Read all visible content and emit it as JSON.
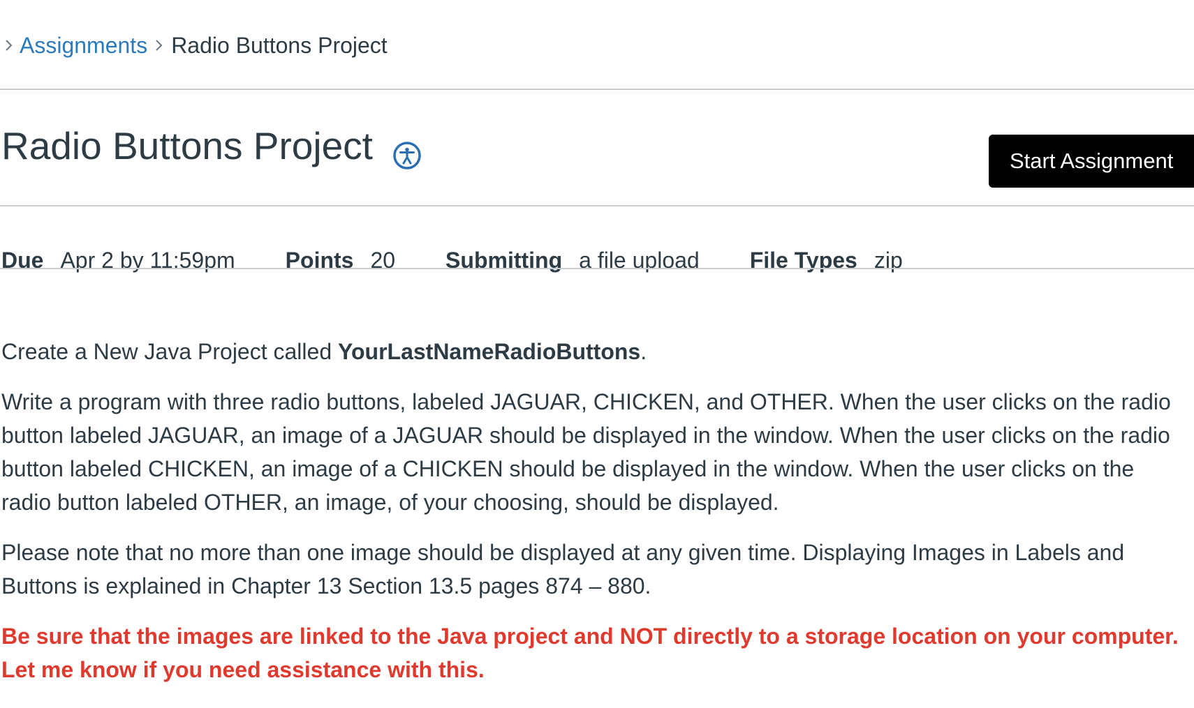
{
  "breadcrumb": {
    "items": [
      {
        "label": "Assignments",
        "link": true
      },
      {
        "label": "Radio Buttons Project",
        "link": false
      }
    ]
  },
  "header": {
    "title": "Radio Buttons Project",
    "start_button_label": "Start Assignment"
  },
  "details": {
    "due_label": "Due",
    "due_value": "Apr 2 by 11:59pm",
    "points_label": "Points",
    "points_value": "20",
    "submitting_label": "Submitting",
    "submitting_value": "a file upload",
    "file_types_label": "File Types",
    "file_types_value": "zip"
  },
  "description": {
    "p1_prefix": "Create a New Java Project called ",
    "p1_project_name": "YourLastNameRadioButtons",
    "p1_suffix": ".",
    "p2": "Write a program with three radio buttons, labeled JAGUAR, CHICKEN, and OTHER.  When the user clicks on the radio button labeled JAGUAR, an image of a JAGUAR should be displayed in the window.  When the user clicks on the radio button labeled CHICKEN, an image of a CHICKEN should be displayed in the window.  When the user clicks on the radio button labeled OTHER, an image, of your choosing, should be displayed.",
    "p3": "Please note that no more than one image should be displayed at any given time.  Displaying Images in Labels and Buttons is explained in Chapter 13 Section 13.5 pages 874 – 880.",
    "p4": "Be sure that the images are linked to the Java project and NOT directly to a storage location on your computer.  Let me know if you need assistance with this."
  },
  "colors": {
    "link": "#2b7abc",
    "text": "#2d3b45",
    "warning": "#e03a2e",
    "button_bg": "#000000",
    "divider": "#c7cdd1"
  },
  "icons": {
    "breadcrumb_separator": "chevron-right-icon",
    "title_badge": "accessibility-icon"
  }
}
